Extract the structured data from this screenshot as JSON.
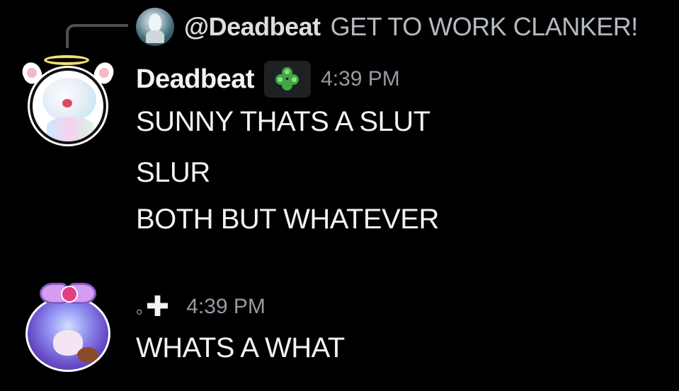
{
  "reply": {
    "author": "@Deadbeat",
    "text": "GET TO WORK CLANKER!"
  },
  "messages": [
    {
      "author": "Deadbeat",
      "server_tag_icon": "clover-icon",
      "timestamp": "4:39 PM",
      "lines": [
        "SUNNY THATS A SLUT",
        "SLUR",
        "BOTH BUT WHATEVER"
      ]
    },
    {
      "author_ring": "○",
      "author_mark": "✚",
      "timestamp": "4:39 PM",
      "lines": [
        "WHATS A WHAT"
      ]
    }
  ],
  "colors": {
    "background": "#000000",
    "text_primary": "#f2f3f5",
    "text_muted": "#949ba4",
    "reply_line": "#4e5058",
    "server_tag_bg": "#1f2023",
    "clover": "#3fa845"
  }
}
